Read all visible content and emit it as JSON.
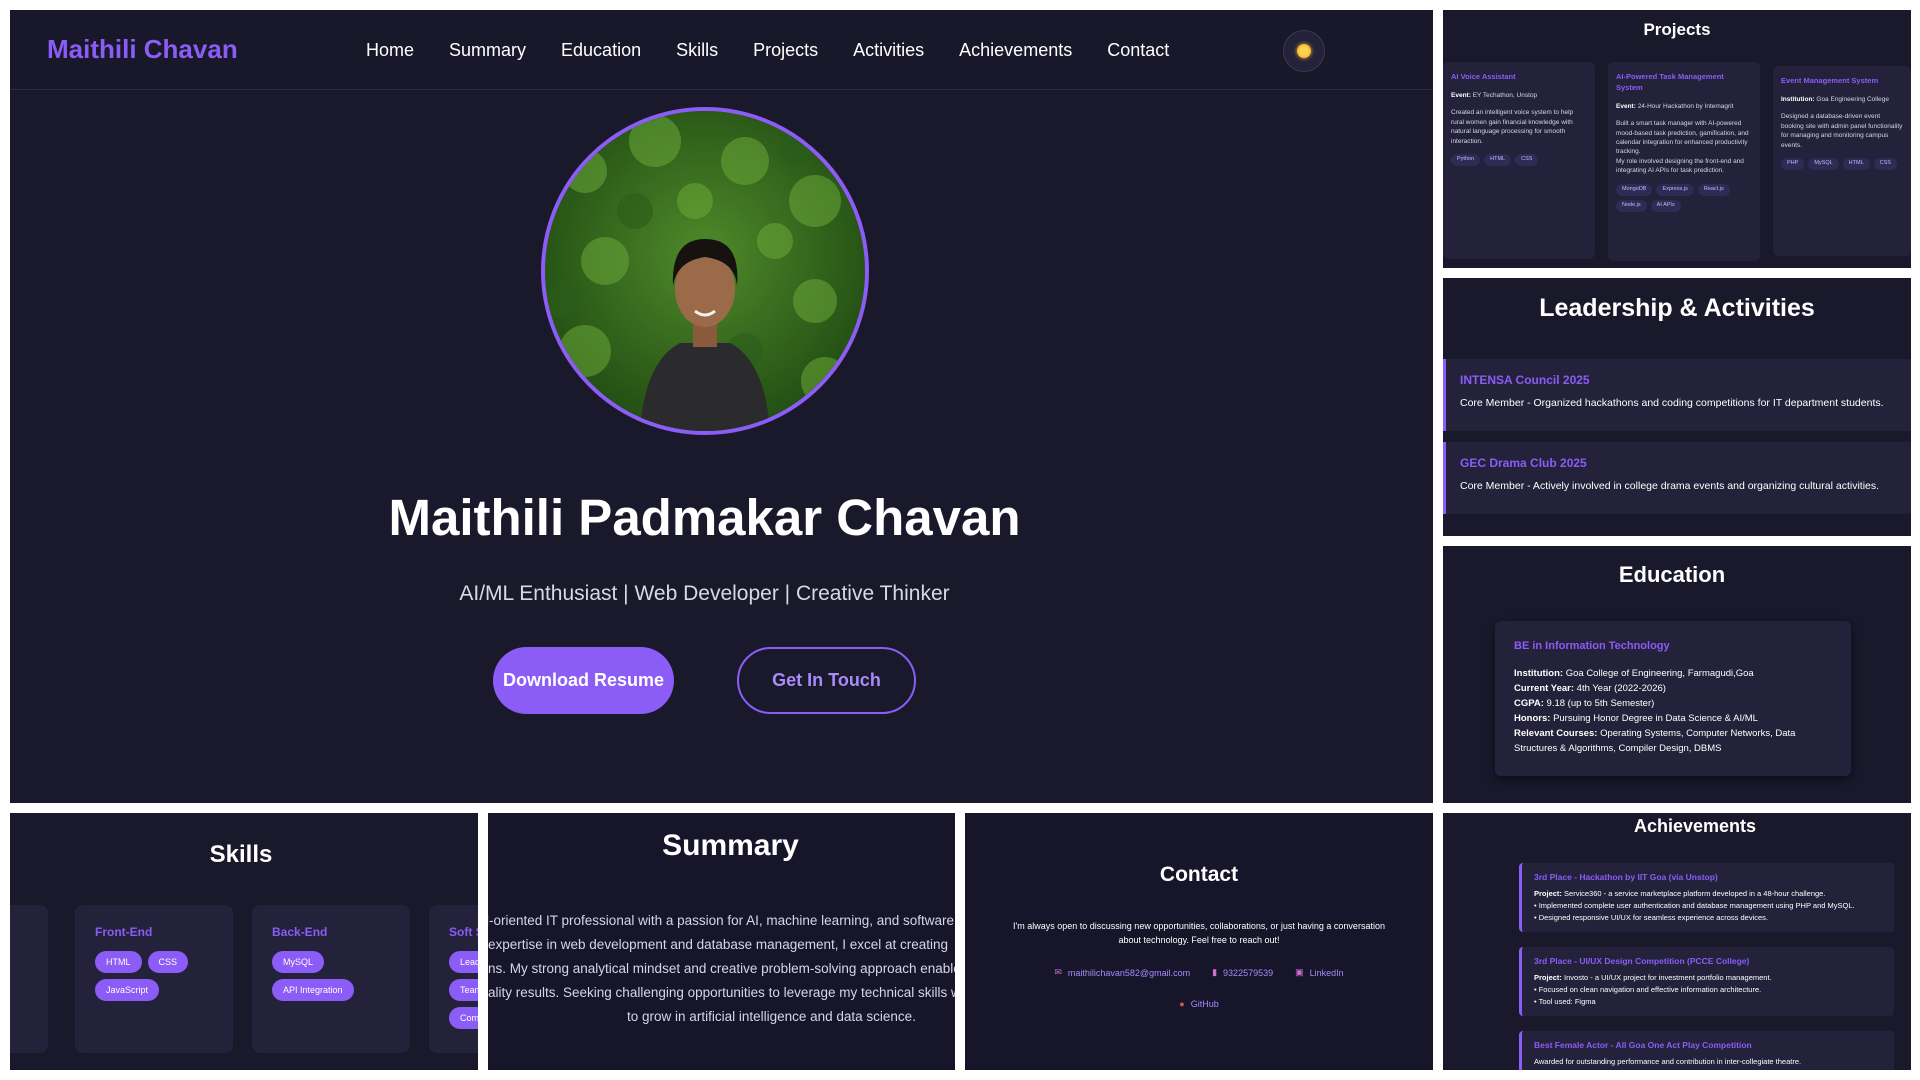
{
  "nav": {
    "logo": "Maithili Chavan",
    "links": [
      "Home",
      "Summary",
      "Education",
      "Skills",
      "Projects",
      "Activities",
      "Achievements",
      "Contact"
    ]
  },
  "hero": {
    "name": "Maithili Padmakar Chavan",
    "tagline": "AI/ML Enthusiast | Web Developer | Creative Thinker",
    "primary_button": "Download Resume",
    "secondary_button": "Get In Touch"
  },
  "projects": {
    "title": "Projects",
    "items": [
      {
        "title": "AI Voice Assistant",
        "event_label": "Event:",
        "event": "EY Techathon, Unstop",
        "desc": "Created an intelligent voice system to help rural women gain financial knowledge with natural language processing for smooth interaction.",
        "tags": [
          "Python",
          "HTML",
          "CSS"
        ]
      },
      {
        "title": "AI-Powered Task Management System",
        "event_label": "Event:",
        "event": "24-Hour Hackathon by Intemagrit",
        "desc": "Built a smart task manager with AI-powered mood-based task prediction, gamification, and calendar integration for enhanced productivity tracking.",
        "desc2": "My role involved designing the front-end and integrating AI APIs for task prediction.",
        "tags": [
          "MongoDB",
          "Express.js",
          "React.js",
          "Node.js",
          "AI APIs"
        ]
      },
      {
        "title": "Event Management System",
        "event_label": "Institution:",
        "event": "Goa Engineering College",
        "desc": "Designed a database-driven event booking site with admin panel functionality for managing and monitoring campus events.",
        "tags": [
          "PHP",
          "MySQL",
          "HTML",
          "CSS"
        ]
      }
    ]
  },
  "leadership": {
    "title": "Leadership & Activities",
    "items": [
      {
        "title": "INTENSA Council 2025",
        "desc": "Core Member - Organized hackathons and coding competitions for IT department students."
      },
      {
        "title": "GEC Drama Club 2025",
        "desc": "Core Member - Actively involved in college drama events and organizing cultural activities."
      }
    ]
  },
  "education": {
    "title": "Education",
    "degree": "BE in Information Technology",
    "rows": [
      {
        "label": "Institution:",
        "value": "Goa College of Engineering, Farmagudi,Goa"
      },
      {
        "label": "Current Year:",
        "value": "4th Year (2022-2026)"
      },
      {
        "label": "CGPA:",
        "value": "9.18 (up to 5th Semester)"
      },
      {
        "label": "Honors:",
        "value": "Pursuing Honor Degree in Data Science & AI/ML"
      },
      {
        "label": "Relevant Courses:",
        "value": "Operating Systems, Computer Networks, Data Structures & Algorithms, Compiler Design, DBMS"
      }
    ]
  },
  "skills": {
    "title": "Skills",
    "cards": [
      {
        "title": "Front-End",
        "tags": [
          "HTML",
          "CSS",
          "JavaScript"
        ]
      },
      {
        "title": "Back-End",
        "tags": [
          "MySQL",
          "API Integration"
        ]
      },
      {
        "title": "Soft S",
        "tags": [
          "Lead",
          "Team",
          "Comm"
        ]
      }
    ]
  },
  "summary": {
    "title": "Summary",
    "lines": [
      "l-oriented IT professional with a passion for AI, machine learning, and software",
      "expertise in web development and database management, I excel at creating",
      "ns. My strong analytical mindset and creative problem-solving approach enable",
      "ality results. Seeking challenging opportunities to leverage my technical skills w",
      "to grow in artificial intelligence and data science."
    ]
  },
  "contact": {
    "title": "Contact",
    "text": "I'm always open to discussing new opportunities, collaborations, or just having a conversation about technology. Feel free to reach out!",
    "email": "maithilichavan582@gmail.com",
    "phone": "9322579539",
    "linkedin": "LinkedIn",
    "github": "GitHub"
  },
  "achievements": {
    "title": "Achievements",
    "items": [
      {
        "title": "3rd Place - Hackathon by IIT Goa (via Unstop)",
        "project_label": "Project:",
        "project": "Service360 - a service marketplace platform developed in a 48-hour challenge.",
        "bullets": [
          "Implemented complete user authentication and database management using PHP and MySQL.",
          "Designed responsive UI/UX for seamless experience across devices."
        ]
      },
      {
        "title": "3rd Place - UI/UX Design Competition (PCCE College)",
        "project_label": "Project:",
        "project": "Invosto - a UI/UX project for investment portfolio management.",
        "bullets": [
          "Focused on clean navigation and effective information architecture.",
          "Tool used: Figma"
        ]
      },
      {
        "title": "Best Female Actor - All Goa One Act Play Competition",
        "text": "Awarded for outstanding performance and contribution in inter-collegiate theatre."
      }
    ]
  },
  "colors": {
    "accent": "#8b5cf6",
    "background": "#1a192c",
    "card": "#23223a"
  }
}
